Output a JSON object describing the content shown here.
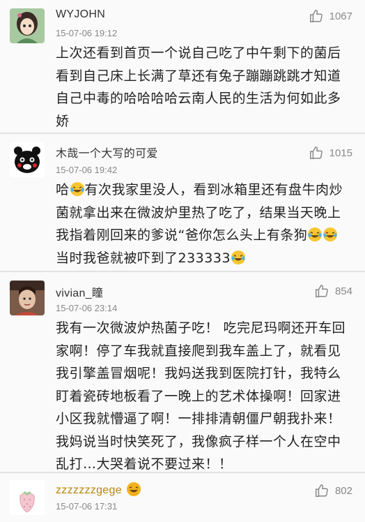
{
  "comments": [
    {
      "username": "WYJOHN",
      "time": "15-07-06 19:12",
      "likes": "1067",
      "text": "上次还看到首页一个说自己吃了中午剩下的菌后看到自己床上长满了草还有兔子蹦蹦跳跳才知道自己中毒的哈哈哈哈云南人民的生活为何如此多娇",
      "avatar_icon": "anime-girl-avatar-icon"
    },
    {
      "username": "木哉一个大写的可爱",
      "time": "15-07-06 19:42",
      "likes": "1015",
      "text_parts": [
        "哈",
        "有次我家里没人，看到冰箱里还有盘牛肉炒菌就拿出来在微波炉里热了吃了，结果当天晚上我指着刚回来的爹说“爸你怎么头上有条狗",
        "当时我爸就被吓到了233333"
      ],
      "avatar_icon": "kumamon-avatar-icon"
    },
    {
      "username": "vivian_瞳",
      "time": "15-07-06 23:14",
      "likes": "854",
      "text": "我有一次微波炉热菌子吃！ 吃完尼玛啊还开车回家啊！停了车我就直接爬到我车盖上了，就看见我引擎盖冒烟呢！我妈送我到医院打针，我特么盯着瓷砖地板看了一晚上的艺术体操啊！回家进小区我就懵逼了啊！一排排清朝僵尸朝我扑来！我妈说当时快笑死了，我像疯子样一个人在空中乱打…大哭着说不要过来！！",
      "avatar_icon": "portrait-avatar-icon"
    },
    {
      "username": "zzzzzzzgege",
      "time": "15-07-06 17:31",
      "likes": "802",
      "avatar_icon": "strawberry-avatar-icon"
    }
  ],
  "colors": {
    "background": "#fafafa",
    "divider": "#e2e2e2",
    "gold_username": "#b8860b",
    "meta": "#888888"
  }
}
